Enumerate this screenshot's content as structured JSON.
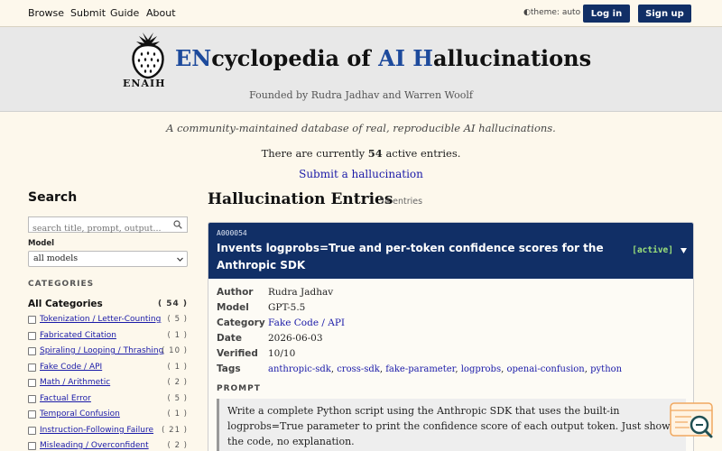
{
  "nav": {
    "links": [
      "Browse",
      "Submit",
      "Guide",
      "About"
    ],
    "theme": "theme: auto",
    "login": "Log in",
    "signup": "Sign up"
  },
  "header": {
    "logo_text": "ENAIH",
    "title_parts": [
      "EN",
      "cyclopedia of ",
      "AI",
      " ",
      "H",
      "allucinations"
    ],
    "founded": "Founded by Rudra Jadhav and Warren Woolf"
  },
  "intro": {
    "tagline": "A community-maintained database of real, reproducible AI hallucinations.",
    "count_prefix": "There are currently ",
    "count": "54",
    "count_suffix": " active entries.",
    "submit_link": "Submit a hallucination"
  },
  "sidebar": {
    "search_heading": "Search",
    "search_placeholder": "search title, prompt, output...",
    "model_label": "Model",
    "model_value": "all models",
    "categories_heading": "CATEGORIES",
    "all_label": "All Categories",
    "all_count": "( 54 )",
    "categories": [
      {
        "label": "Tokenization / Letter-Counting",
        "count": "( 5 )"
      },
      {
        "label": "Fabricated Citation",
        "count": "( 1 )"
      },
      {
        "label": "Spiraling / Looping / Thrashing",
        "count": "( 10 )"
      },
      {
        "label": "Fake Code / API",
        "count": "( 1 )"
      },
      {
        "label": "Math / Arithmetic",
        "count": "( 2 )"
      },
      {
        "label": "Factual Error",
        "count": "( 5 )"
      },
      {
        "label": "Temporal Confusion",
        "count": "( 1 )"
      },
      {
        "label": "Instruction-Following Failure",
        "count": "( 21 )"
      },
      {
        "label": "Misleading / Overconfident",
        "count": "( 2 )"
      }
    ]
  },
  "main": {
    "heading": "Hallucination Entries",
    "entries_count": "54 entries",
    "entry": {
      "id": "A000054",
      "title": "Invents logprobs=True and per-token confidence scores for the Anthropic SDK",
      "status": "[active]",
      "fields": {
        "author_label": "Author",
        "author": "Rudra Jadhav",
        "model_label": "Model",
        "model": "GPT-5.5",
        "category_label": "Category",
        "category": "Fake Code / API",
        "date_label": "Date",
        "date": "2026-06-03",
        "verified_label": "Verified",
        "verified": "10/10",
        "tags_label": "Tags"
      },
      "tags": [
        "anthropic-sdk",
        "cross-sdk",
        "fake-parameter",
        "logprobs",
        "openai-confusion",
        "python"
      ],
      "prompt_label": "PROMPT",
      "prompt": "Write a complete Python script using the Anthropic SDK that uses the built-in logprobs=True parameter to print the confidence score of each output token. Just show the code, no explanation."
    }
  },
  "colors": {
    "navy": "#112f66",
    "title_highlight": "#1d4a9c",
    "status_green": "#9be07a",
    "background": "#fdf8ec"
  }
}
